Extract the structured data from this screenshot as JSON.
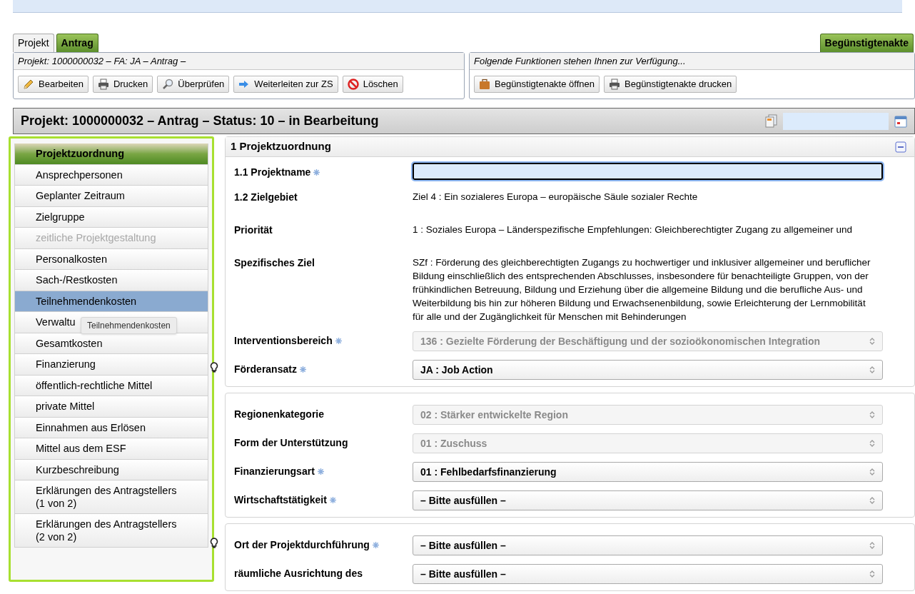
{
  "top_tabs": [
    {
      "label": "Projekt",
      "selected": false
    },
    {
      "label": "Antrag",
      "selected": true
    }
  ],
  "right_tab": {
    "label": "Begünstigtenakte"
  },
  "left_panel": {
    "title": "Projekt: 1000000032 – FA: JA – Antrag –",
    "buttons": [
      {
        "label": "Bearbeiten",
        "kind": "pencil"
      },
      {
        "label": "Drucken",
        "kind": "printer"
      },
      {
        "label": "Überprüfen",
        "kind": "magnifier"
      },
      {
        "label": "Weiterleiten zur ZS",
        "kind": "arrow"
      },
      {
        "label": "Löschen",
        "kind": "forbidden"
      }
    ]
  },
  "right_panel": {
    "title": "Folgende Funktionen stehen Ihnen zur Verfügung...",
    "buttons": [
      {
        "label": "Begünstigtenakte öffnen",
        "kind": "briefcase"
      },
      {
        "label": "Begünstigtenakte drucken",
        "kind": "printer"
      }
    ]
  },
  "title_bar": {
    "title": "Projekt: 1000000032 – Antrag – Status: 10 – in Bearbeitung"
  },
  "sidebar": {
    "tooltip": "Teilnehmendenkosten",
    "items": [
      {
        "label": "Projektzuordnung",
        "selected": true,
        "hovered": false,
        "disabled": false
      },
      {
        "label": "Ansprechpersonen",
        "selected": false,
        "hovered": false,
        "disabled": false
      },
      {
        "label": "Geplanter Zeitraum",
        "selected": false,
        "hovered": false,
        "disabled": false
      },
      {
        "label": "Zielgruppe",
        "selected": false,
        "hovered": false,
        "disabled": false
      },
      {
        "label": "zeitliche Projektgestaltung",
        "selected": false,
        "hovered": false,
        "disabled": true
      },
      {
        "label": "Personalkosten",
        "selected": false,
        "hovered": false,
        "disabled": false
      },
      {
        "label": "Sach-/Restkosten",
        "selected": false,
        "hovered": false,
        "disabled": false
      },
      {
        "label": "Teilnehmendenkosten",
        "selected": false,
        "hovered": true,
        "disabled": false
      },
      {
        "label": "Verwaltu",
        "selected": false,
        "hovered": false,
        "disabled": false
      },
      {
        "label": "Gesamtkosten",
        "selected": false,
        "hovered": false,
        "disabled": false
      },
      {
        "label": "Finanzierung",
        "selected": false,
        "hovered": false,
        "disabled": false
      },
      {
        "label": "öffentlich-rechtliche Mittel",
        "selected": false,
        "hovered": false,
        "disabled": false
      },
      {
        "label": "private Mittel",
        "selected": false,
        "hovered": false,
        "disabled": false
      },
      {
        "label": "Einnahmen aus Erlösen",
        "selected": false,
        "hovered": false,
        "disabled": false
      },
      {
        "label": "Mittel aus dem ESF",
        "selected": false,
        "hovered": false,
        "disabled": false
      },
      {
        "label": "Kurzbeschreibung",
        "selected": false,
        "hovered": false,
        "disabled": false
      },
      {
        "label": "Erklärungen des Antragstellers (1 von 2)",
        "selected": false,
        "hovered": false,
        "disabled": false
      },
      {
        "label": "Erklärungen des Antragstellers (2 von 2)",
        "selected": false,
        "hovered": false,
        "disabled": false
      }
    ]
  },
  "sections": [
    {
      "title": "1 Projektzuordnung",
      "rows": [
        {
          "label": "1.1 Projektname",
          "kind": "input",
          "value": "",
          "required": true,
          "hint": false,
          "disabled": false
        },
        {
          "label": "1.2 Zielgebiet",
          "kind": "text",
          "value": "Ziel 4 : Ein sozialeres Europa – europäische Säule sozialer Rechte",
          "required": false,
          "hint": false,
          "disabled": false
        },
        {
          "label": "Priorität",
          "kind": "text",
          "value": "1 : Soziales Europa – Länderspezifische Empfehlungen: Gleichberechtigter Zugang zu allgemeiner und",
          "required": false,
          "hint": false,
          "disabled": false
        },
        {
          "label": "Spezifisches Ziel",
          "kind": "text",
          "value": "SZf : Förderung des gleichberechtigten Zugangs zu hochwertiger und inklusiver allgemeiner und beruflicher Bildung einschließlich des entsprechenden Abschlusses, insbesondere für benachteiligte Gruppen, von der frühkindlichen Betreuung, Bildung und Erziehung über die allgemeine Bildung und die berufliche Aus- und Weiterbildung bis hin zur höheren Bildung und Erwachsenenbildung, sowie Erleichterung der Lernmobilität für alle und der Zugänglichkeit für Menschen mit Behinderungen",
          "required": false,
          "hint": false,
          "disabled": false
        },
        {
          "label": "Interventionsbereich",
          "kind": "select",
          "value": "136 : Gezielte Förderung der Beschäftigung und der sozioökonomischen Integration",
          "required": true,
          "hint": false,
          "disabled": true
        },
        {
          "label": "Förderansatz",
          "kind": "select",
          "value": "JA : Job Action",
          "required": true,
          "hint": true,
          "disabled": false
        }
      ]
    },
    {
      "rows": [
        {
          "label": "Regionenkategorie",
          "kind": "select",
          "value": "02 : Stärker entwickelte Region",
          "required": false,
          "hint": false,
          "disabled": true
        },
        {
          "label": "Form der Unterstützung",
          "kind": "select",
          "value": "01 : Zuschuss",
          "required": false,
          "hint": false,
          "disabled": true
        },
        {
          "label": "Finanzierungsart",
          "kind": "select",
          "value": "01 : Fehlbedarfsfinanzierung",
          "required": true,
          "hint": false,
          "disabled": false
        },
        {
          "label": "Wirtschaftstätigkeit",
          "kind": "select",
          "value": "– Bitte ausfüllen –",
          "required": true,
          "hint": false,
          "disabled": false
        }
      ]
    },
    {
      "rows": [
        {
          "label": "Ort der Projektdurchführung",
          "kind": "select",
          "value": "– Bitte ausfüllen –",
          "required": true,
          "hint": true,
          "disabled": false
        },
        {
          "label": "räumliche Ausrichtung des",
          "kind": "select",
          "value": "– Bitte ausfüllen –",
          "required": false,
          "hint": false,
          "disabled": false
        }
      ]
    }
  ]
}
